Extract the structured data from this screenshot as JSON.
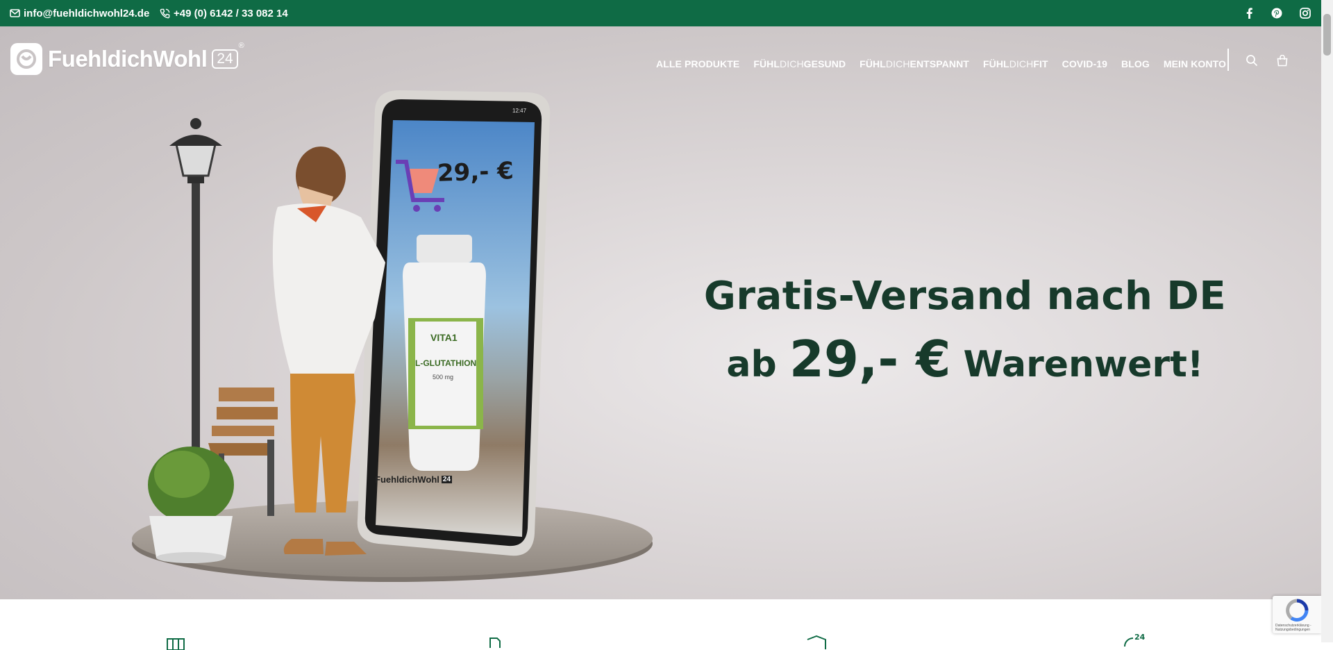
{
  "topbar": {
    "email": "info@fuehldichwohl24.de",
    "phone": "+49 (0) 6142 / 33 082 14",
    "social": [
      "facebook-icon",
      "pinterest-icon",
      "instagram-icon"
    ]
  },
  "header": {
    "logo_text": "FuehldichWohl",
    "logo_badge": "24",
    "logo_reg": "®",
    "nav": [
      {
        "label": "ALLE PRODUKTE"
      },
      {
        "bold": "FÜHL",
        "thin": "DICH",
        "rest": "GESUND"
      },
      {
        "bold": "FÜHL",
        "thin": "DICH",
        "rest": "ENTSPANNT"
      },
      {
        "bold": "FÜHL",
        "thin": "DICH",
        "rest": "FIT"
      },
      {
        "label": "COVID-19"
      },
      {
        "label": "BLOG"
      },
      {
        "label": "MEIN KONTO"
      }
    ],
    "icons": [
      "search-icon",
      "cart-icon"
    ]
  },
  "hero": {
    "line1": "Gratis-Versand nach DE",
    "line2_prefix": "ab",
    "line2_price": "29,- €",
    "line2_suffix": "Warenwert!",
    "image_description_alt": "Figur vor Smartphone mit Produkt VITA1 L-GLUTATHION",
    "phone_price": "29,- €",
    "product_brand": "VITA1",
    "product_name": "L-GLUTATHION",
    "product_dose": "500 mg",
    "phone_time": "12:47",
    "phone_logo": "FuehldichWohl",
    "phone_logo_badge": "24"
  },
  "recaptcha": {
    "text": "Datenschutzerklärung - Nutzungsbedingungen"
  },
  "colors": {
    "topbar": "#0f6b45",
    "headline": "#173a2b",
    "hero_bg": "#d6d1d2"
  }
}
